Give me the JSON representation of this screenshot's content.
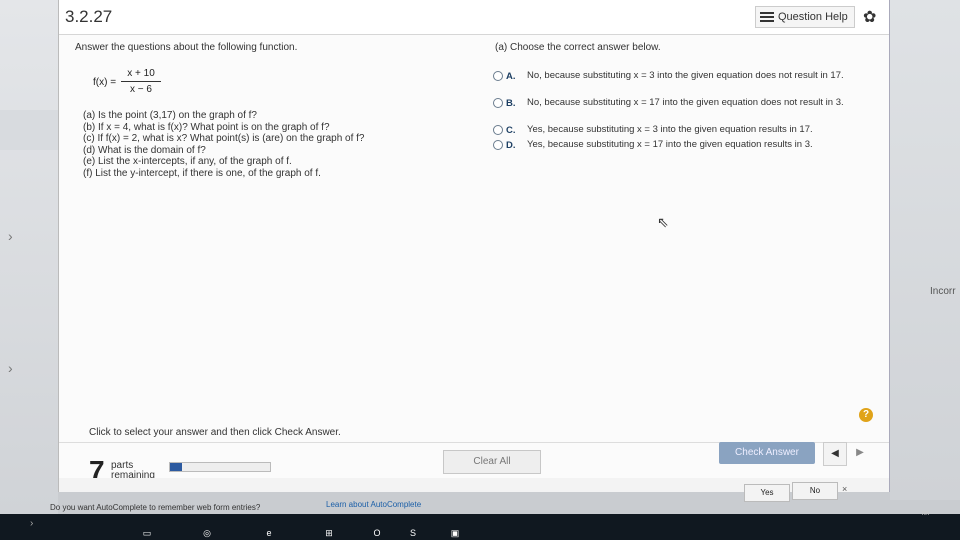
{
  "header": {
    "title": "3.2.27",
    "question_help": "Question Help"
  },
  "problem": {
    "prompt": "Answer the questions about the following function.",
    "function_lhs": "f(x) =",
    "numerator": "x + 10",
    "denominator": "x − 6",
    "questions": [
      "(a) Is the point (3,17) on the graph of f?",
      "(b) If x = 4, what is f(x)? What point is on the graph of f?",
      "(c) If f(x) = 2, what is x? What point(s) is (are) on the graph of f?",
      "(d) What is the domain of f?",
      "(e) List the x-intercepts, if any, of the graph of f.",
      "(f) List the y-intercept, if there is one, of the graph of f."
    ]
  },
  "answer": {
    "title": "(a) Choose the correct answer below.",
    "options": [
      {
        "letter": "A.",
        "text": "No, because substituting x = 3 into the given equation does not result in 17."
      },
      {
        "letter": "B.",
        "text": "No, because substituting x = 17 into the given equation does not result in 3."
      },
      {
        "letter": "C.",
        "text": "Yes, because substituting x = 3 into the given equation results in 17."
      },
      {
        "letter": "D.",
        "text": "Yes, because substituting x = 17 into the given equation results in 3."
      }
    ]
  },
  "footer": {
    "instruction": "Click to select your answer and then click Check Answer.",
    "parts_count": "7",
    "parts_label_1": "parts",
    "parts_label_2": "remaining",
    "progress_fraction": 0.12,
    "help_symbol": "?",
    "clear_all": "Clear All",
    "check_answer": "Check Answer",
    "prev_symbol": "◀",
    "next_symbol": "▶"
  },
  "autocomplete": {
    "message": "Do you want AutoComplete to remember web form entries?",
    "learn_link": "Learn about AutoComplete",
    "yes": "Yes",
    "no": "No",
    "close_symbol": "×"
  },
  "side": {
    "right_text": "Incorr",
    "chev": "›"
  },
  "taskbar": {
    "icons": [
      "folder-icon",
      "chrome-icon",
      "edge-icon",
      "windows-icon",
      "outlook-icon",
      "skype-icon",
      "app-icon"
    ],
    "tray": "ᴿᴿ"
  }
}
